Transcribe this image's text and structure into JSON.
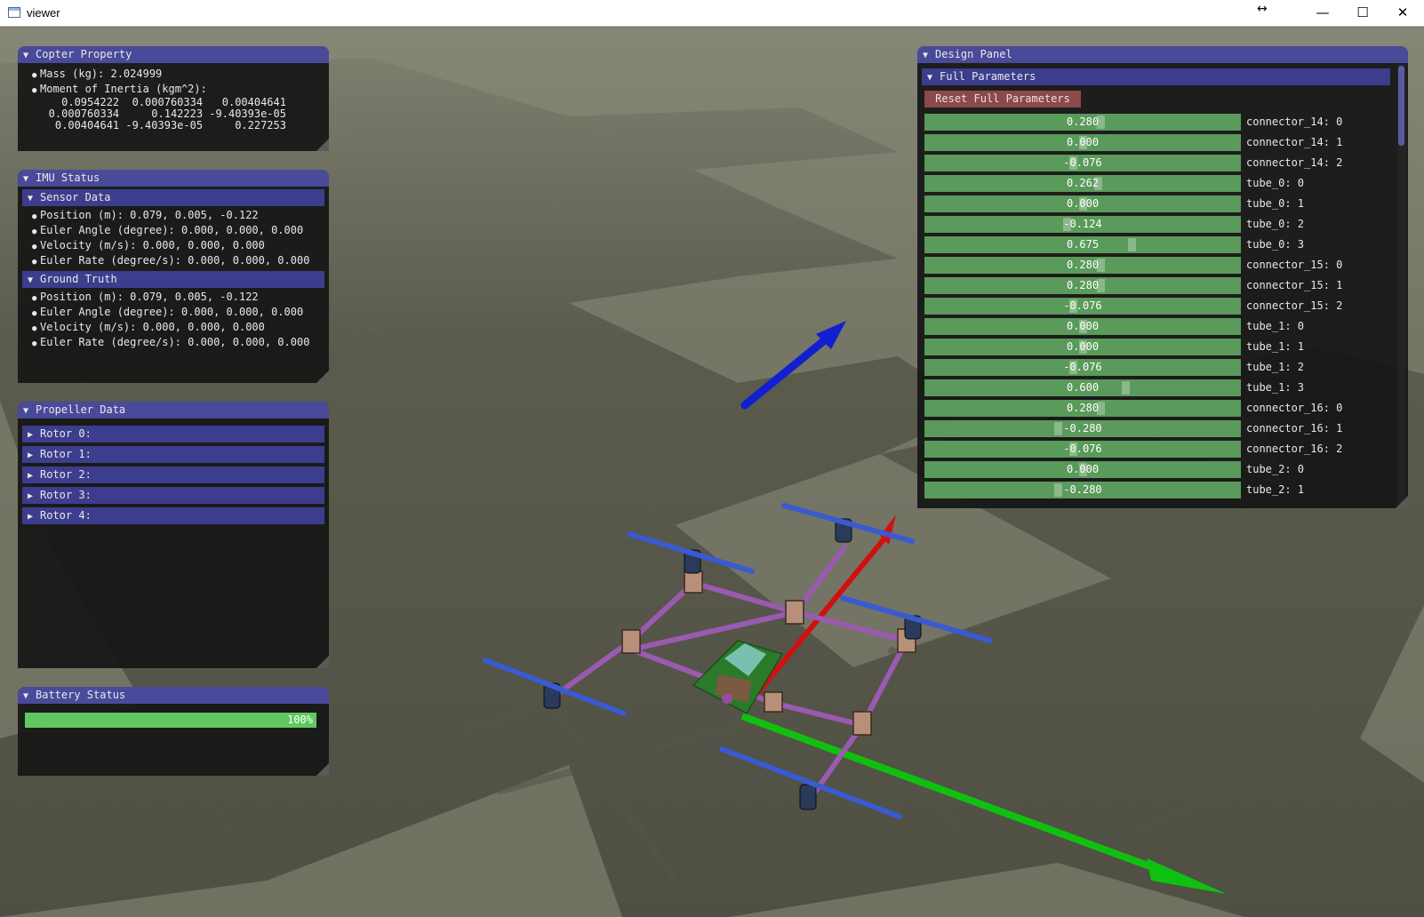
{
  "window": {
    "title": "viewer",
    "minimize": "—",
    "maximize": "☐",
    "close": "✕",
    "resize_cursor": "↔"
  },
  "copter_property": {
    "header": "Copter Property",
    "mass": "Mass (kg): 2.024999",
    "moi_label": "Moment of Inertia (kgm^2):",
    "moi_rows": [
      "     0.0954222  0.000760334   0.00404641",
      "   0.000760334     0.142223 -9.40393e-05",
      "    0.00404641 -9.40393e-05     0.227253"
    ]
  },
  "imu_status": {
    "header": "IMU Status",
    "sensor_header": "Sensor Data",
    "sensor": [
      "Position (m): 0.079, 0.005, -0.122",
      "Euler Angle (degree): 0.000, 0.000, 0.000",
      "Velocity (m/s): 0.000, 0.000, 0.000",
      "Euler Rate (degree/s): 0.000, 0.000, 0.000"
    ],
    "ground_header": "Ground Truth",
    "ground": [
      "Position (m): 0.079, 0.005, -0.122",
      "Euler Angle (degree): 0.000, 0.000, 0.000",
      "Velocity (m/s): 0.000, 0.000, 0.000",
      "Euler Rate (degree/s): 0.000, 0.000, 0.000"
    ]
  },
  "propeller_data": {
    "header": "Propeller Data",
    "rotors": [
      "Rotor 0:",
      "Rotor 1:",
      "Rotor 2:",
      "Rotor 3:",
      "Rotor 4:"
    ]
  },
  "battery_status": {
    "header": "Battery Status",
    "level_text": "100%",
    "level": 1.0
  },
  "design_panel": {
    "header": "Design Panel",
    "full_params_header": "Full Parameters",
    "reset_label": "Reset Full Parameters",
    "params": [
      {
        "value": "0.280",
        "label": "connector_14: 0",
        "frac": 0.56
      },
      {
        "value": "0.000",
        "label": "connector_14: 1",
        "frac": 0.5
      },
      {
        "value": "-0.076",
        "label": "connector_14: 2",
        "frac": 0.47
      },
      {
        "value": "0.262",
        "label": "tube_0: 0",
        "frac": 0.55
      },
      {
        "value": "0.000",
        "label": "tube_0: 1",
        "frac": 0.5
      },
      {
        "value": "-0.124",
        "label": "tube_0: 2",
        "frac": 0.45
      },
      {
        "value": "0.675",
        "label": "tube_0: 3",
        "frac": 0.66
      },
      {
        "value": "0.280",
        "label": "connector_15: 0",
        "frac": 0.56
      },
      {
        "value": "0.280",
        "label": "connector_15: 1",
        "frac": 0.56
      },
      {
        "value": "-0.076",
        "label": "connector_15: 2",
        "frac": 0.47
      },
      {
        "value": "0.000",
        "label": "tube_1: 0",
        "frac": 0.5
      },
      {
        "value": "0.000",
        "label": "tube_1: 1",
        "frac": 0.5
      },
      {
        "value": "-0.076",
        "label": "tube_1: 2",
        "frac": 0.47
      },
      {
        "value": "0.600",
        "label": "tube_1: 3",
        "frac": 0.64
      },
      {
        "value": "0.280",
        "label": "connector_16: 0",
        "frac": 0.56
      },
      {
        "value": "-0.280",
        "label": "connector_16: 1",
        "frac": 0.42
      },
      {
        "value": "-0.076",
        "label": "connector_16: 2",
        "frac": 0.47
      },
      {
        "value": "0.000",
        "label": "tube_2: 0",
        "frac": 0.5
      },
      {
        "value": "-0.280",
        "label": "tube_2: 1",
        "frac": 0.42
      }
    ]
  },
  "colors": {
    "panel_header": "#4a4a9a",
    "slider": "#5a9a5a",
    "battery": "#60c860",
    "reset_button": "#8a4a4a",
    "axis_x": "#d01010",
    "axis_y": "#10c010",
    "axis_z": "#1020d0",
    "frame": "#9a5ab0",
    "propeller": "#3a5ad0"
  }
}
